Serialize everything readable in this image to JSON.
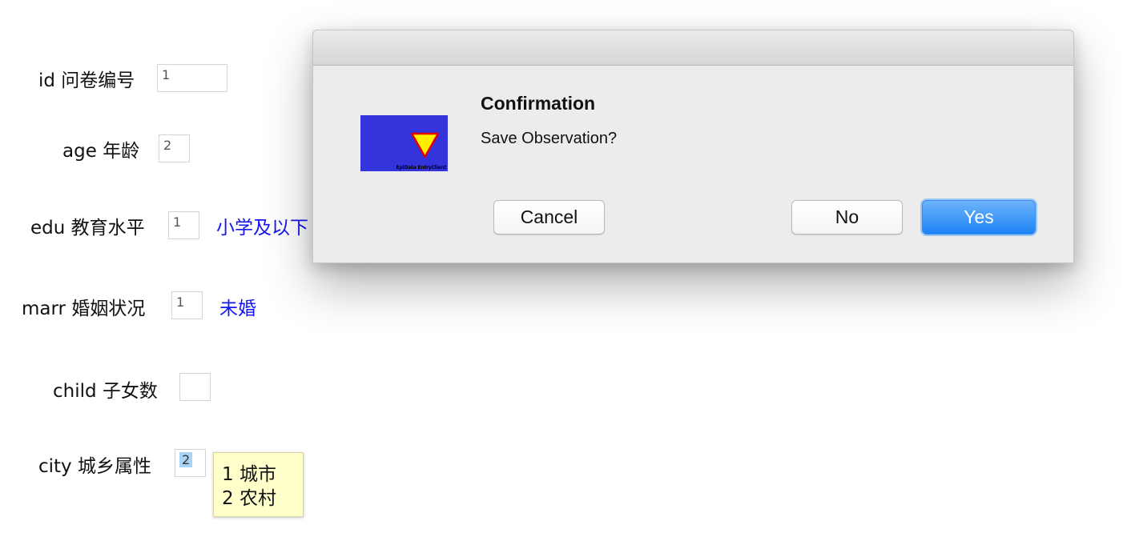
{
  "form": {
    "fields": [
      {
        "label": "id 问卷编号",
        "value": "1",
        "value_label": ""
      },
      {
        "label": "age 年龄",
        "value": "2",
        "value_label": ""
      },
      {
        "label": "edu 教育水平",
        "value": "1",
        "value_label": "小学及以下"
      },
      {
        "label": "marr 婚姻状况",
        "value": "1",
        "value_label": "未婚"
      },
      {
        "label": "child 子女数",
        "value": "",
        "value_label": ""
      },
      {
        "label": "city 城乡属性",
        "value": "2",
        "value_label": ""
      }
    ],
    "tooltip": {
      "lines": [
        "1 城市",
        "2 农村"
      ]
    }
  },
  "dialog": {
    "title": "Confirmation",
    "message": "Save Observation?",
    "icon_caption": "EpiData EntryClient",
    "icon_name": "epidata-app-icon",
    "buttons": {
      "cancel": "Cancel",
      "no": "No",
      "yes": "Yes"
    }
  },
  "colors": {
    "value_label": "#1515ee",
    "icon_background": "#3434dc",
    "icon_triangle": "#ffee00",
    "icon_triangle_border": "#e00000",
    "yes_button": "#1e84f5",
    "tooltip_background": "#ffffcc",
    "selection_highlight": "#a8d4f8"
  }
}
